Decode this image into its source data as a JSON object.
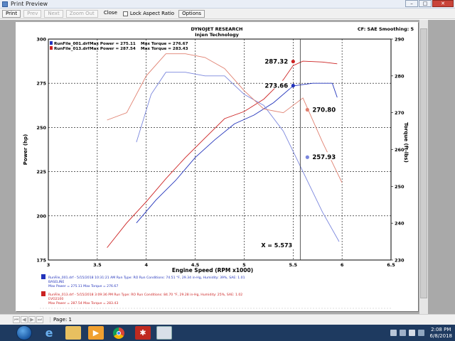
{
  "window": {
    "title": "Print Preview",
    "controls": [
      "–",
      "□",
      "✕"
    ]
  },
  "toolbar": {
    "print": "Print",
    "prev": "Prev",
    "next": "Next",
    "zoom_out": "Zoom Out",
    "close": "Close",
    "lock_aspect": "Lock Aspect Ratio",
    "options": "Options"
  },
  "report": {
    "company": "DYNOJET RESEARCH",
    "subtitle": "Injen Technology",
    "settings": "CF: SAE  Smoothing: 5",
    "legend": [
      {
        "file": "RunFile_001.drf",
        "max_power": "Max Power = 275.11",
        "max_torque": "Max Torque = 276.67",
        "color": "#2233bb"
      },
      {
        "file": "RunFile_013.drf",
        "max_power": "Max Power = 287.54",
        "max_torque": "Max Torque = 283.43",
        "color": "#cc2222"
      }
    ],
    "runs": [
      {
        "line1": "RunFile_001.drf - 5/15/2018 10:31:21 AM  Run Type: RO  Run Conditions: 74.51 °F, 29.34 in-Hg,  Humidity:  39%, SAE: 1.01",
        "line2": "BASELINE",
        "line3": "Max Power = 275.11  Max Torque = 276.67",
        "color": "#2233bb"
      },
      {
        "line1": "RunFile_013.drf - 5/15/2018 3:09:36 PM  Run Type: RO  Run Conditions: 84.70 °F, 29.28 in-Hg,  Humidity:  25%, SAE: 1.02",
        "line2": "EVO2100",
        "line3": "Max Power = 287.54  Max Torque = 283.43",
        "color": "#cc2222"
      }
    ]
  },
  "chart_data": {
    "type": "line",
    "xlabel": "Engine Speed (RPM x1000)",
    "ylabel": "Power (hp)",
    "y2label": "Torque (ft-lbs)",
    "xlim": [
      3,
      6.5
    ],
    "xticks": [
      "3",
      "3.5",
      "4",
      "4.5",
      "5",
      "5.5",
      "6",
      "6.5"
    ],
    "ylim": [
      175,
      300
    ],
    "yticks": [
      "175",
      "200",
      "225",
      "250",
      "275",
      "300"
    ],
    "y2lim": [
      230,
      290
    ],
    "y2ticks": [
      "230",
      "240",
      "250",
      "260",
      "270",
      "280",
      "290"
    ],
    "grid": true,
    "cursor": {
      "x": 5.573,
      "label": "X = 5.573"
    },
    "cursor_values": [
      {
        "label": "287.32",
        "series": "RunFile_013.drf power",
        "y": 287.32,
        "axis": "left",
        "color": "#cc2222"
      },
      {
        "label": "273.66",
        "series": "RunFile_001.drf power",
        "y": 273.66,
        "axis": "left",
        "color": "#2233bb"
      },
      {
        "label": "270.80",
        "series": "RunFile_013.drf torque",
        "y": 270.8,
        "axis": "right",
        "color": "#e08070"
      },
      {
        "label": "257.93",
        "series": "RunFile_001.drf torque",
        "y": 257.93,
        "axis": "right",
        "color": "#7a86dd"
      }
    ],
    "series": [
      {
        "name": "RunFile_001.drf",
        "quantity": "power",
        "axis": "left",
        "color": "#2233bb",
        "x": [
          3.9,
          4.1,
          4.3,
          4.5,
          4.7,
          4.9,
          5.1,
          5.3,
          5.5,
          5.7,
          5.9,
          5.95
        ],
        "y": [
          196,
          209,
          220,
          233,
          243,
          252,
          257,
          264,
          273.5,
          275,
          275,
          267
        ]
      },
      {
        "name": "RunFile_013.drf",
        "quantity": "power",
        "axis": "left",
        "color": "#cc2222",
        "x": [
          3.6,
          3.8,
          4.0,
          4.2,
          4.4,
          4.6,
          4.8,
          5.0,
          5.2,
          5.4,
          5.5,
          5.6,
          5.8,
          5.95
        ],
        "y": [
          182,
          196,
          208,
          221,
          233,
          244,
          255,
          259,
          266,
          277,
          285,
          287.5,
          287,
          286
        ]
      },
      {
        "name": "RunFile_001.drf",
        "quantity": "torque",
        "axis": "right",
        "color": "#7a86dd",
        "x": [
          3.9,
          4.05,
          4.2,
          4.4,
          4.6,
          4.8,
          5.0,
          5.2,
          5.4,
          5.6,
          5.8,
          5.97
        ],
        "y": [
          262,
          275,
          281,
          281,
          280,
          280,
          275,
          272,
          265,
          254,
          243,
          235
        ]
      },
      {
        "name": "RunFile_013.drf",
        "quantity": "torque",
        "axis": "right",
        "color": "#e08070",
        "x": [
          3.6,
          3.8,
          4.0,
          4.2,
          4.4,
          4.6,
          4.8,
          5.0,
          5.2,
          5.4,
          5.6,
          5.8,
          6.0
        ],
        "y": [
          268,
          270,
          280,
          286,
          286,
          285,
          282,
          276,
          271,
          270,
          274,
          262,
          251
        ]
      }
    ]
  },
  "pagebar": {
    "page_label": "Page: 1"
  },
  "taskbar": {
    "time": "2:08 PM",
    "date": "6/8/2018"
  }
}
